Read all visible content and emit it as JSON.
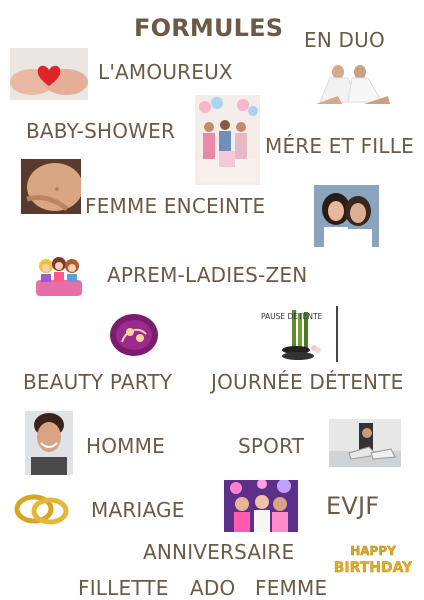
{
  "title": "FORMULES",
  "labels": {
    "en_duo": "EN DUO",
    "amoureux": "L'AMOUREUX",
    "baby_shower": "BABY-SHOWER",
    "mere_fille": "MÉRE ET FILLE",
    "femme_enceinte": "FEMME ENCEINTE",
    "aprem_ladies_zen": "APREM-LADIES-ZEN",
    "beauty_party": "BEAUTY PARTY",
    "journee_detente": "JOURNÉE DÉTENTE",
    "homme": "HOMME",
    "sport": "SPORT",
    "mariage": "MARIAGE",
    "evjf": "EVJF",
    "anniversaire": "ANNIVERSAIRE",
    "fillette": "FILLETTE",
    "ado": "ADO",
    "femme": "FEMME"
  },
  "images": {
    "pause_detente_text": "PAUSE DÉTENTE",
    "happy_text": "HAPPY",
    "birthday_text": "BIRTHDAY"
  },
  "colors": {
    "text": "#6b5a47",
    "gold": "#d9a521",
    "heart": "#e0252a",
    "purple": "#7a1d6e"
  }
}
